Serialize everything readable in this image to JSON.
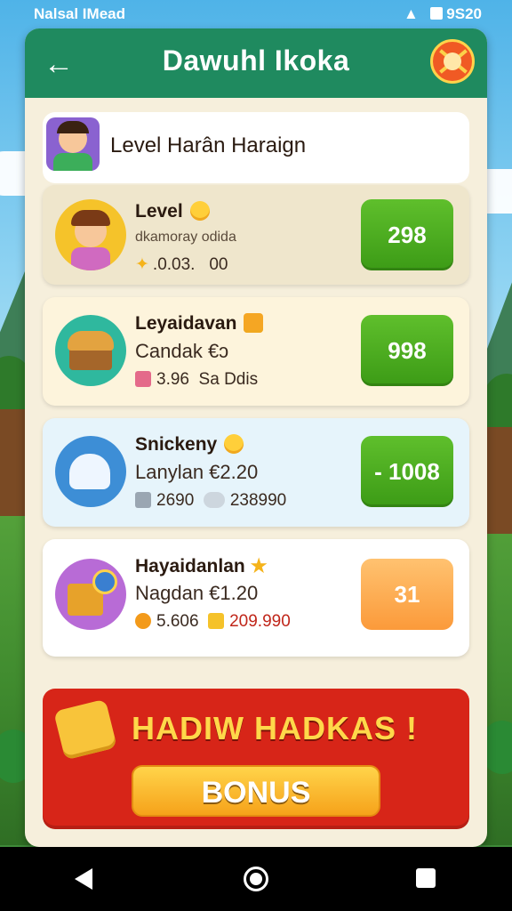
{
  "status_bar": {
    "left_text": "Nalsal IMead",
    "time": "9S20"
  },
  "header": {
    "title": "Dawuhl Ikoka"
  },
  "level_banner": {
    "title": "Level Harân Haraign"
  },
  "cards": [
    {
      "name": "Level",
      "subtitle": "dkamoray odida",
      "meta1": ".0.03.",
      "meta2": "00",
      "button": "298",
      "button_style": "green",
      "bg": "#efe6cc"
    },
    {
      "name": "Leyaidavan",
      "subtitle": "Candak €ɔ",
      "meta1": "3.96",
      "meta2": "Sa Ddis",
      "button": "998",
      "button_style": "green",
      "bg": "#fdf4dc"
    },
    {
      "name": "Snickeny",
      "subtitle": "Lanylan €2.20",
      "meta1": "2690",
      "meta2": "238990",
      "button": "- 1008",
      "button_style": "green",
      "bg": "#e6f4fb"
    },
    {
      "name": "Hayaidanlan",
      "subtitle": "Nagdan €1.20",
      "meta1": "5.606",
      "meta2": "209.990",
      "button": "31",
      "button_style": "orange",
      "bg": "#ffffff"
    }
  ],
  "bonus": {
    "title": "HADIW HADKAS !",
    "button": "BONUS"
  },
  "colors": {
    "header": "#1f8a5f",
    "panel": "#f6efdc",
    "bonus_bg": "#d72518",
    "green_button": "#4aa81f",
    "orange_button": "#fbaa4c"
  }
}
